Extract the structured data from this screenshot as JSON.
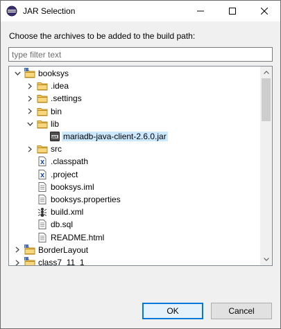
{
  "window": {
    "title": "JAR Selection"
  },
  "prompt": "Choose the archives to be added to the build path:",
  "filter": {
    "value": "",
    "placeholder": "type filter text"
  },
  "tree": {
    "items": [
      {
        "label": "booksys",
        "icon": "project-folder-icon",
        "expander": "expanded",
        "selected": false
      },
      {
        "label": ".idea",
        "icon": "folder-icon",
        "expander": "collapsed",
        "selected": false
      },
      {
        "label": ".settings",
        "icon": "folder-icon",
        "expander": "collapsed",
        "selected": false
      },
      {
        "label": "bin",
        "icon": "folder-icon",
        "expander": "collapsed",
        "selected": false
      },
      {
        "label": "lib",
        "icon": "folder-icon",
        "expander": "expanded",
        "selected": false
      },
      {
        "label": "mariadb-java-client-2.6.0.jar",
        "icon": "jar-icon",
        "expander": "none",
        "selected": true
      },
      {
        "label": "src",
        "icon": "folder-icon",
        "expander": "collapsed",
        "selected": false
      },
      {
        "label": ".classpath",
        "icon": "xml-file-icon",
        "expander": "none",
        "selected": false
      },
      {
        "label": ".project",
        "icon": "xml-file-icon",
        "expander": "none",
        "selected": false
      },
      {
        "label": "booksys.iml",
        "icon": "text-file-icon",
        "expander": "none",
        "selected": false
      },
      {
        "label": "booksys.properties",
        "icon": "text-file-icon",
        "expander": "none",
        "selected": false
      },
      {
        "label": "build.xml",
        "icon": "ant-build-icon",
        "expander": "none",
        "selected": false
      },
      {
        "label": "db.sql",
        "icon": "text-file-icon",
        "expander": "none",
        "selected": false
      },
      {
        "label": "README.html",
        "icon": "text-file-icon",
        "expander": "none",
        "selected": false
      },
      {
        "label": "BorderLayout",
        "icon": "project-folder-icon",
        "expander": "collapsed",
        "selected": false
      },
      {
        "label": "class7_11_1",
        "icon": "project-folder-icon",
        "expander": "collapsed",
        "selected": false
      }
    ]
  },
  "buttons": {
    "ok": "OK",
    "cancel": "Cancel"
  },
  "colors": {
    "selection": "#cce8ff",
    "default_button_border": "#0078d7",
    "folder": "#e8b84a"
  }
}
